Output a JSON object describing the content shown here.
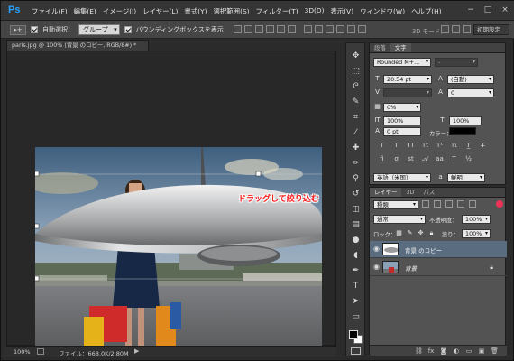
{
  "app": {
    "logo": "Ps"
  },
  "menu": {
    "items": [
      "ファイル(F)",
      "編集(E)",
      "イメージ(I)",
      "レイヤー(L)",
      "書式(Y)",
      "選択範囲(S)",
      "フィルター(T)",
      "3D(D)",
      "表示(V)",
      "ウィンドウ(W)",
      "ヘルプ(H)"
    ]
  },
  "window": {
    "minimize": "−",
    "maximize": "□",
    "close": "×"
  },
  "options": {
    "move_tool_icon": "▸+",
    "auto_select_label": "自動選択：",
    "auto_select_value": "グループ",
    "bounding_box_label": "バウンディングボックスを表示",
    "mode3d_label": "3D モード：",
    "workspace_value": "初期設定"
  },
  "document": {
    "tab_title": "paris.jpg @ 100% (背景 のコピー, RGB/8#) *",
    "annotation": "ドラッグして絞り込む"
  },
  "status": {
    "zoom": "100%",
    "file_info": "ファイル：668.0K/2.80M",
    "arrow": "▶"
  },
  "character_panel": {
    "tabs": [
      "段落",
      "文字"
    ],
    "font_family": "Rounded M+...",
    "font_style": "-",
    "font_size": "20.54 pt",
    "leading": "(自動)",
    "kerning": "",
    "tracking": "0",
    "tsume": "0%",
    "vertical_scale": "100%",
    "horizontal_scale": "100%",
    "baseline_shift": "0 pt",
    "color_label": "カラー：",
    "language": "英語（米国）",
    "antialias": "鮮明"
  },
  "layers_panel": {
    "tabs": [
      "レイヤー",
      "3D",
      "パス"
    ],
    "filter_type": "種類",
    "blend_mode": "通常",
    "opacity_label": "不透明度：",
    "opacity_value": "100%",
    "lock_label": "ロック：",
    "fill_label": "塗り：",
    "fill_value": "100%",
    "layers": [
      {
        "name": "背景 のコピー",
        "selected": true
      },
      {
        "name": "背景",
        "selected": false,
        "locked": true
      }
    ]
  },
  "icons": {
    "eye": "eye-icon",
    "lock": "lock-icon",
    "move": "move-tool-icon"
  },
  "colors": {
    "ps_blue": "#29a3ff",
    "annotation_red": "#ff1c1c",
    "selected_layer": "#5a6c80",
    "foreground": "#000000",
    "background": "#ffffff"
  }
}
